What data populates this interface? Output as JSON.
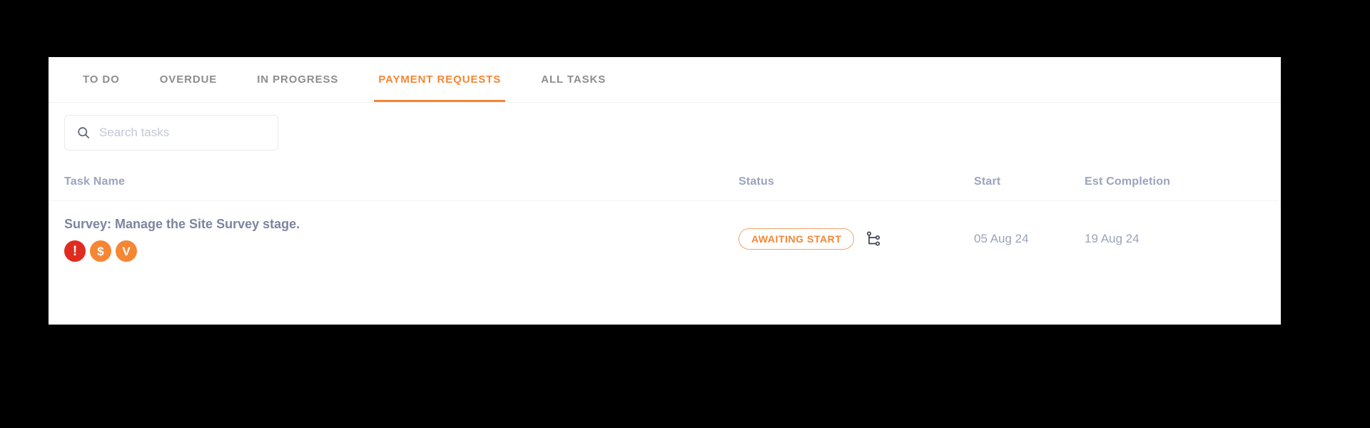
{
  "theme": {
    "accent": "#f58634",
    "accent_border": "#f6a468",
    "alert_red": "#e02b20",
    "muted_text": "#9ba3bd",
    "tab_inactive": "#8d8d8d",
    "card_bg": "#ffffff",
    "page_bg": "#000000"
  },
  "tabs": [
    {
      "label": "TO DO",
      "active": false
    },
    {
      "label": "OVERDUE",
      "active": false
    },
    {
      "label": "IN PROGRESS",
      "active": false
    },
    {
      "label": "PAYMENT REQUESTS",
      "active": true
    },
    {
      "label": "ALL TASKS",
      "active": false
    }
  ],
  "search": {
    "value": "",
    "placeholder": "Search tasks",
    "icon": "search-icon"
  },
  "table": {
    "columns": [
      {
        "key": "name",
        "label": "Task Name"
      },
      {
        "key": "status",
        "label": "Status"
      },
      {
        "key": "start",
        "label": "Start"
      },
      {
        "key": "est",
        "label": "Est Completion"
      }
    ],
    "rows": [
      {
        "name": "Survey: Manage the Site Survey stage.",
        "badges": [
          {
            "icon": "alert-badge-icon",
            "glyph": "!",
            "color": "#e02b20",
            "title": "Alert"
          },
          {
            "icon": "payment-badge-icon",
            "glyph": "$",
            "color": "#f58634",
            "title": "Payment"
          },
          {
            "icon": "variation-badge-icon",
            "glyph": "V",
            "color": "#f58634",
            "title": "Variation"
          }
        ],
        "status": "AWAITING START",
        "status_icon": "workflow-branch-icon",
        "start": "05 Aug 24",
        "est_completion": "19 Aug 24"
      }
    ]
  }
}
